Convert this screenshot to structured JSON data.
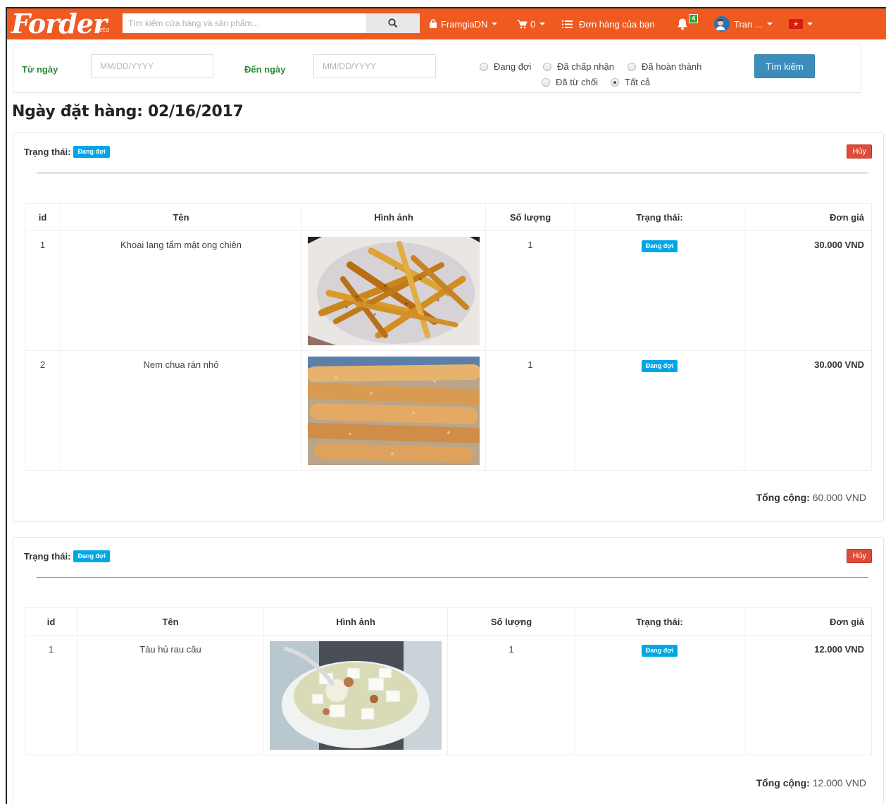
{
  "navbar": {
    "logo": "Forder",
    "logo_beta": "beta",
    "search_placeholder": "Tìm kiếm cửa hàng và sản phẩm...",
    "shop": "FramgiaDN",
    "cart_count": "0",
    "orders_link": "Đơn hàng của bạn",
    "notification_count": "4",
    "user": "Tran ...",
    "colors": {
      "bar": "#ef5a21"
    }
  },
  "filter": {
    "from_label": "Từ ngày",
    "to_label": "Đến ngày",
    "from_placeholder": "MM/DD/YYYY",
    "to_placeholder": "MM/DD/YYYY",
    "radios": [
      {
        "label": "Đang đợi",
        "checked": false
      },
      {
        "label": "Đã chấp nhận",
        "checked": false
      },
      {
        "label": "Đã hoàn thành",
        "checked": false
      },
      {
        "label": "Đã từ chối",
        "checked": false
      },
      {
        "label": "Tất cả",
        "checked": true
      }
    ],
    "submit": "Tìm kiếm"
  },
  "order_date": "Ngày đặt hàng: 02/16/2017",
  "orders": [
    {
      "status_label": "Trạng thái:",
      "status_badge": "Đang đợi",
      "cancel": "Hủy",
      "columns": [
        "id",
        "Tên",
        "Hình ảnh",
        "Số lượng",
        "Trạng thái:",
        "Đơn giá"
      ],
      "items": [
        {
          "id": "1",
          "name": "Khoai lang tẩm mật ong chiên",
          "image": "sweet-potato-fries-image",
          "qty": "1",
          "status": "Đang đợi",
          "price": "30.000 VND"
        },
        {
          "id": "2",
          "name": "Nem chua rán nhỏ",
          "image": "fried-nem-chua-image",
          "qty": "1",
          "status": "Đang đợi",
          "price": "30.000 VND"
        }
      ],
      "total_label": "Tổng cộng:",
      "total_value": "60.000 VND"
    },
    {
      "status_label": "Trạng thái:",
      "status_badge": "Đang đợi",
      "cancel": "Hủy",
      "columns": [
        "id",
        "Tên",
        "Hình ảnh",
        "Số lượng",
        "Trạng thái:",
        "Đơn giá"
      ],
      "items": [
        {
          "id": "1",
          "name": "Tàu hủ rau câu",
          "image": "tofu-jelly-dessert-image",
          "qty": "1",
          "status": "Đang đợi",
          "price": "12.000 VND"
        }
      ],
      "total_label": "Tổng cộng:",
      "total_value": "12.000 VND"
    }
  ]
}
